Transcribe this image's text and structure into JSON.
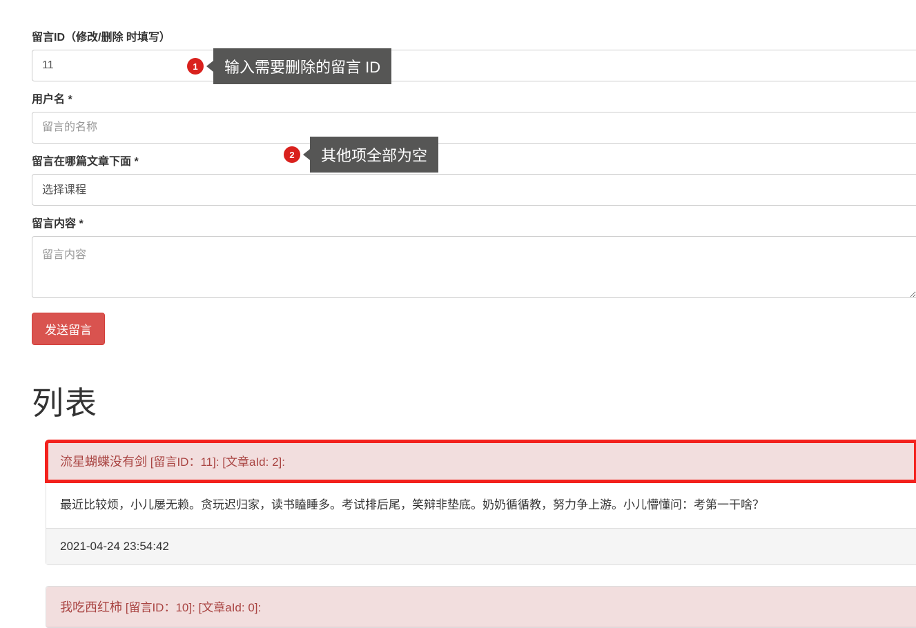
{
  "form": {
    "msgid_label": "留言ID（修改/删除 时填写）",
    "msgid_value": "11",
    "username_label": "用户名 *",
    "username_placeholder": "留言的名称",
    "article_label": "留言在哪篇文章下面 *",
    "article_select_default": "选择课程",
    "content_label": "留言内容 *",
    "content_placeholder": "留言内容",
    "submit_label": "发送留言"
  },
  "annotations": {
    "a1_num": "1",
    "a1_text": "输入需要删除的留言 ID",
    "a2_num": "2",
    "a2_text": "其他项全部为空"
  },
  "list": {
    "heading": "列表",
    "items": [
      {
        "title_main": "流星蝴蝶没有剑",
        "title_meta": " [留言ID：11]: [文章aId: 2]:",
        "body": "最近比较烦，小儿屡无赖。贪玩迟归家，读书瞌睡多。考试排后尾，笑辩非垫底。奶奶循循教，努力争上游。小儿懵懂问：考第一干啥？",
        "timestamp": "2021-04-24 23:54:42",
        "highlighted": true
      },
      {
        "title_main": "我吃西红柿",
        "title_meta": " [留言ID：10]: [文章aId: 0]:",
        "body": "",
        "timestamp": "",
        "highlighted": false
      }
    ]
  }
}
